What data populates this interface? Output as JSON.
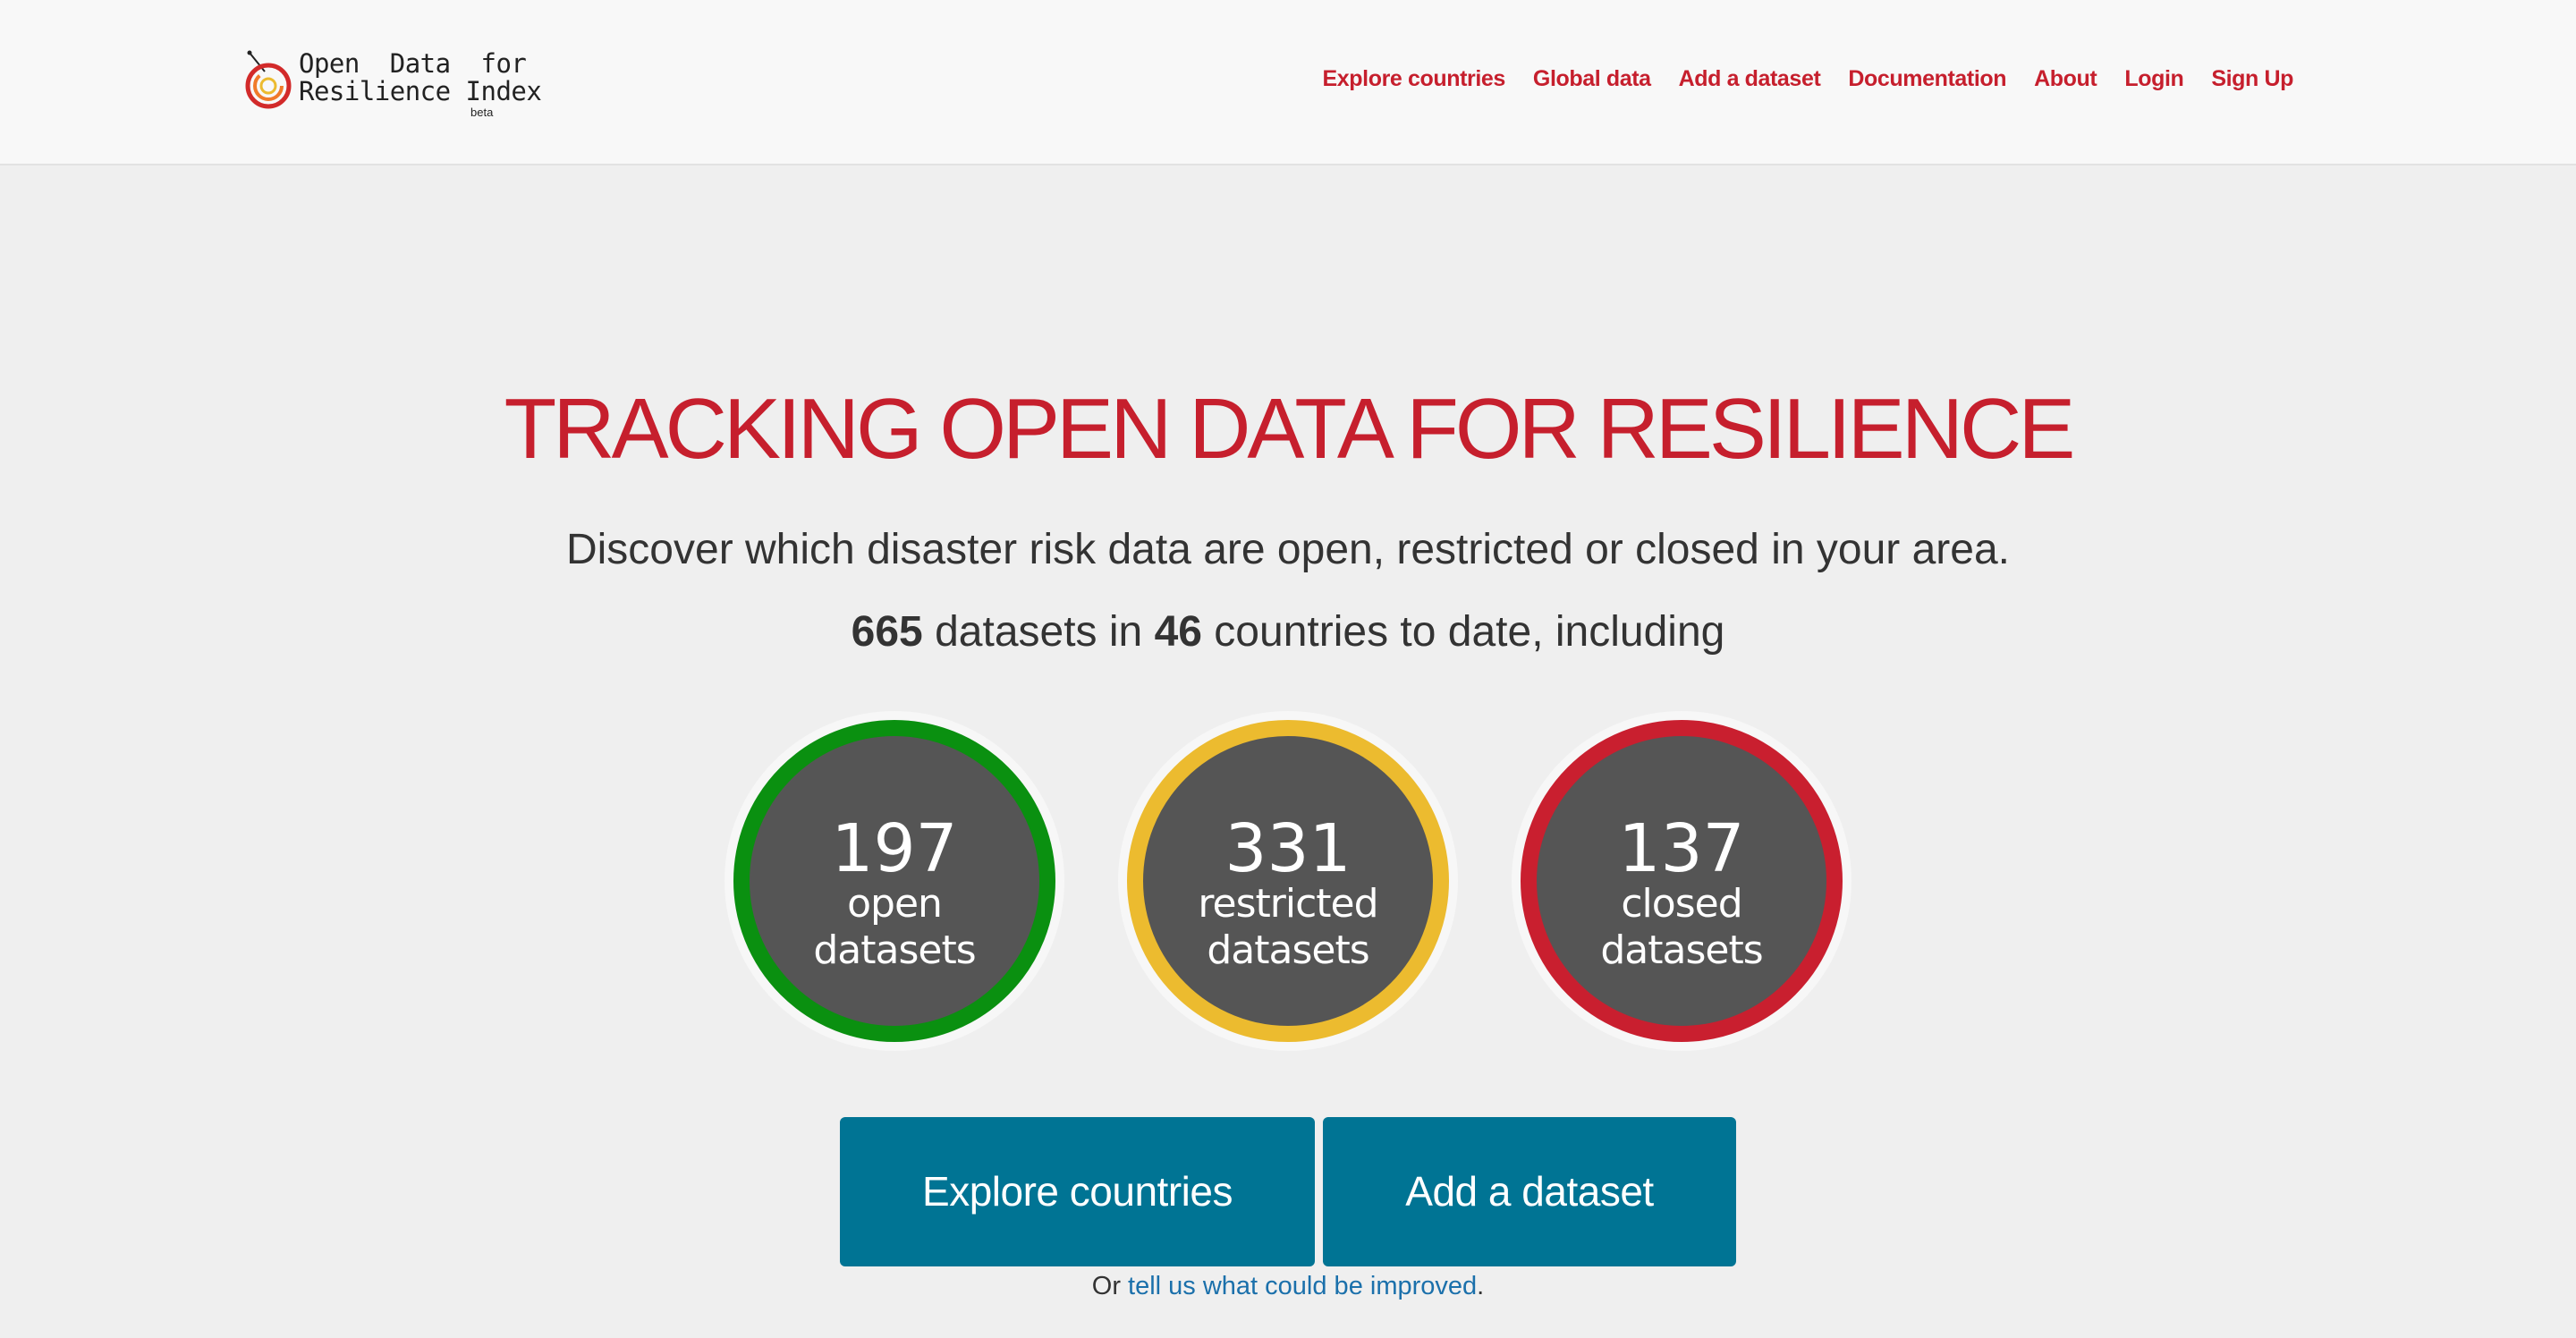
{
  "brand": {
    "line1": "Open  Data  for",
    "line2": "Resilience Index",
    "beta": "beta",
    "logo_icon": "odri-logo-icon"
  },
  "nav": {
    "items": [
      {
        "label": "Explore countries"
      },
      {
        "label": "Global data"
      },
      {
        "label": "Add a dataset"
      },
      {
        "label": "Documentation"
      },
      {
        "label": "About"
      },
      {
        "label": "Login"
      },
      {
        "label": "Sign Up"
      }
    ]
  },
  "hero": {
    "title": "TRACKING OPEN DATA FOR RESILIENCE",
    "subtitle": "Discover which disaster risk data are open, restricted or closed in your area.",
    "datasets_count": "665",
    "text_datasets_in": " datasets in ",
    "countries_count": "46",
    "text_countries_to_date": " countries to date, including"
  },
  "stats": {
    "open": {
      "value": "197",
      "line1": "open",
      "line2": "datasets",
      "color": "#0a9010"
    },
    "restricted": {
      "value": "331",
      "line1": "restricted",
      "line2": "datasets",
      "color": "#ecbb2f"
    },
    "closed": {
      "value": "137",
      "line1": "closed",
      "line2": "datasets",
      "color": "#c91f2f"
    }
  },
  "actions": {
    "explore_label": "Explore countries",
    "add_label": "Add a dataset"
  },
  "feedback": {
    "prefix": "Or ",
    "link": "tell us what could be improved",
    "suffix": "."
  },
  "colors": {
    "accent_red": "#c61f2d",
    "button_blue": "#007494",
    "link_blue": "#1b70ab",
    "background": "#efefef"
  }
}
